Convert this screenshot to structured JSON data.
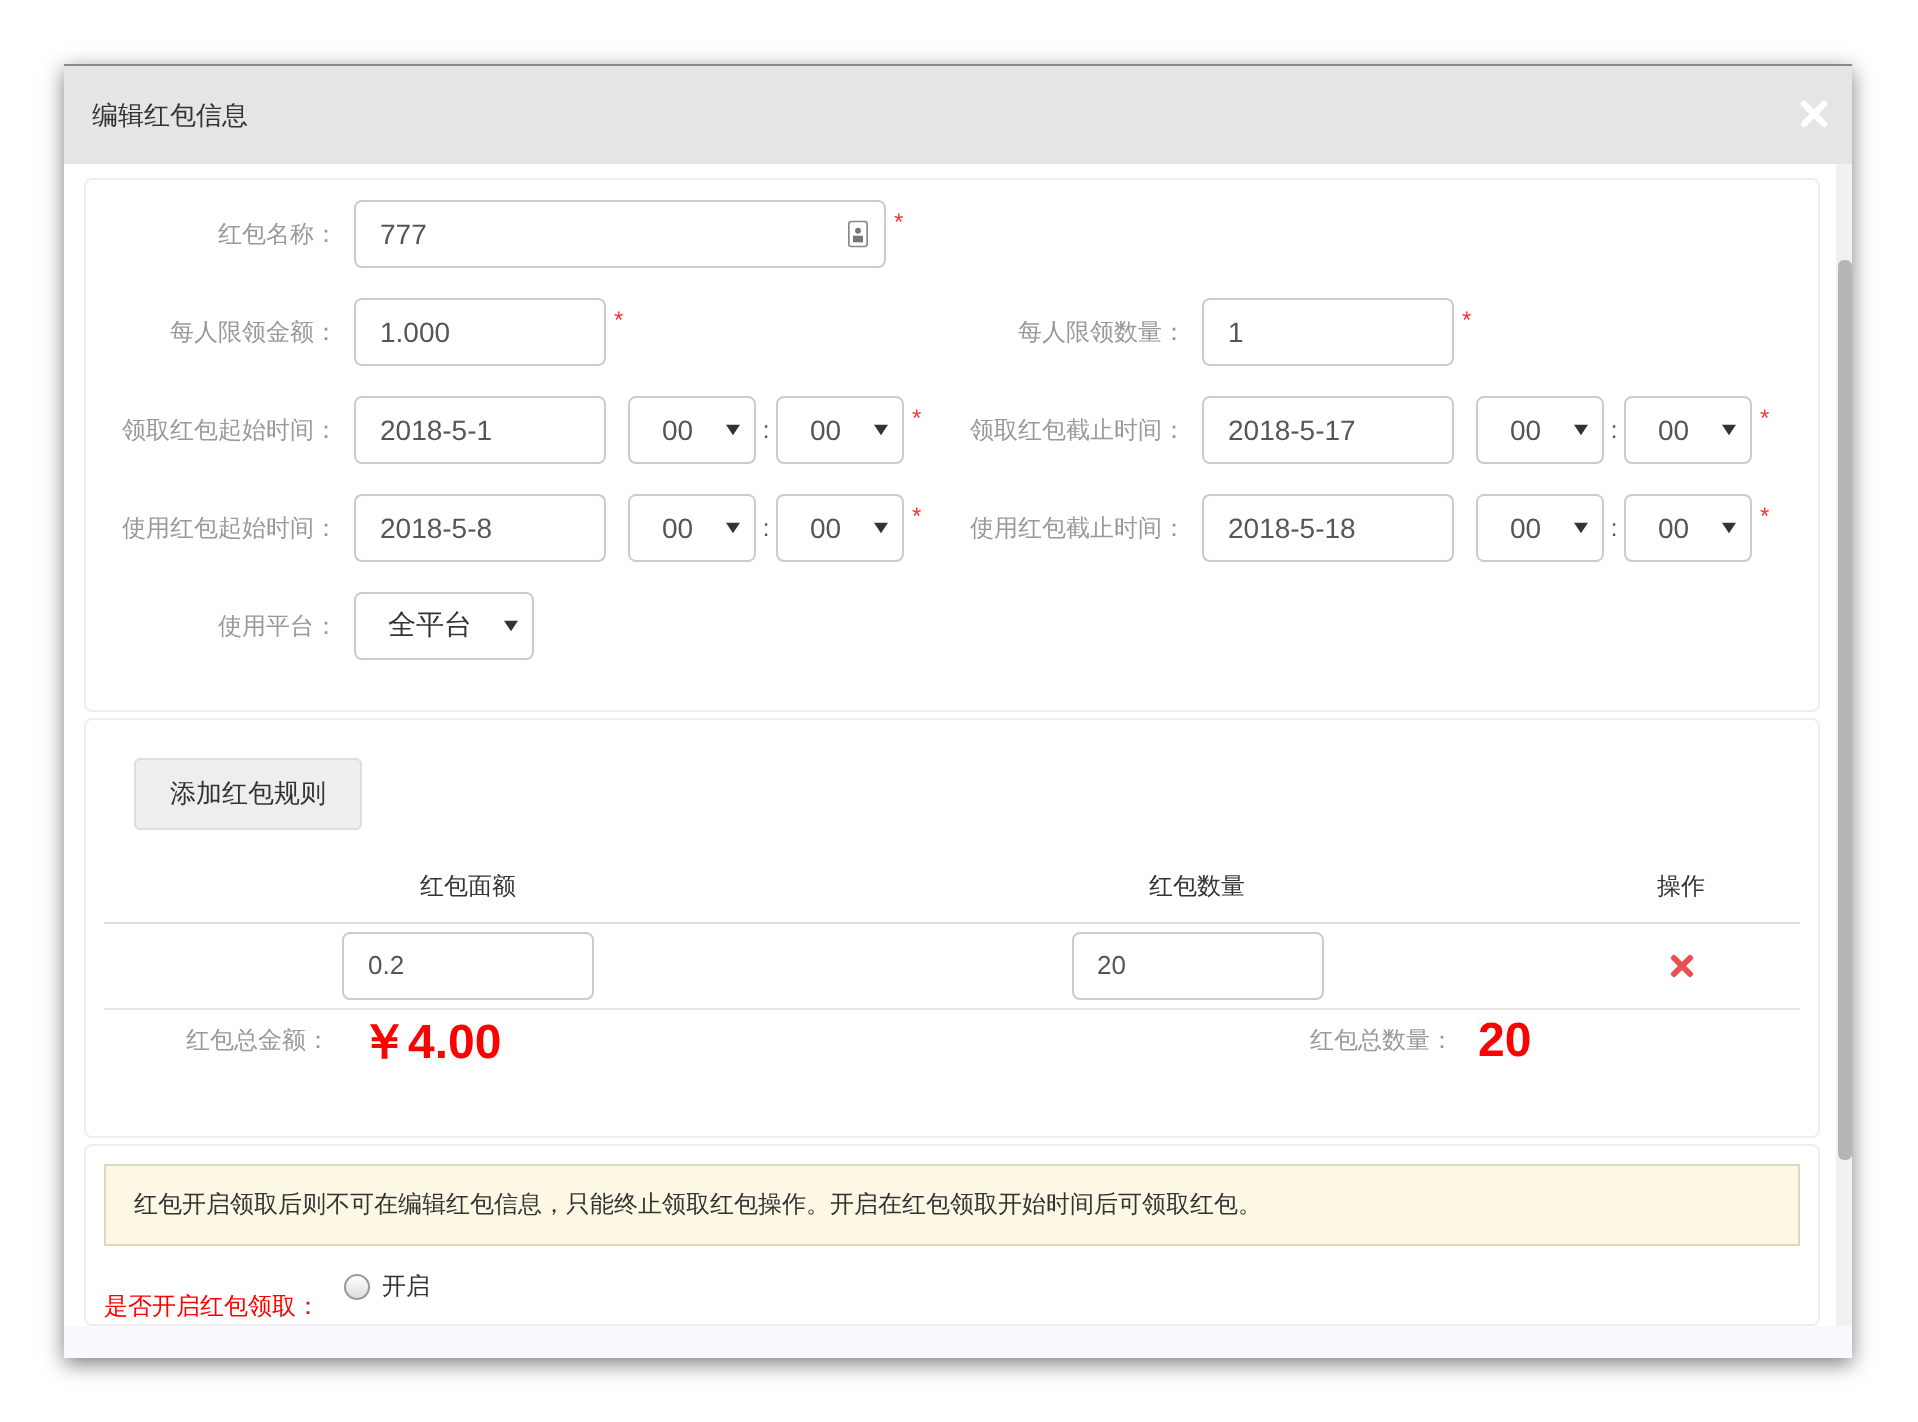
{
  "dialog": {
    "title": "编辑红包信息"
  },
  "form": {
    "name": {
      "label": "红包名称：",
      "value": "777",
      "required": true
    },
    "limits": [
      {
        "label": "每人限领金额：",
        "value": "1.000",
        "required": true
      },
      {
        "label": "每人限领数量：",
        "value": "1",
        "required": true
      }
    ],
    "times": [
      {
        "label": "领取红包起始时间：",
        "date": "2018-5-1",
        "hour": "00",
        "minute": "00",
        "required": true
      },
      {
        "label": "领取红包截止时间：",
        "date": "2018-5-17",
        "hour": "00",
        "minute": "00",
        "required": true
      },
      {
        "label": "使用红包起始时间：",
        "date": "2018-5-8",
        "hour": "00",
        "minute": "00",
        "required": true
      },
      {
        "label": "使用红包截止时间：",
        "date": "2018-5-18",
        "hour": "00",
        "minute": "00",
        "required": true
      }
    ],
    "time_separator": ":",
    "required_mark": "*",
    "platform": {
      "label": "使用平台：",
      "value": "全平台"
    }
  },
  "rules": {
    "add_button": "添加红包规则",
    "columns": [
      "红包面额",
      "红包数量",
      "操作"
    ],
    "rows": [
      {
        "amount": "0.2",
        "count": "20"
      }
    ],
    "totals": {
      "amount_label": "红包总金额：",
      "amount": "￥4.00",
      "count_label": "红包总数量：",
      "count": "20"
    }
  },
  "activation": {
    "notice": "红包开启领取后则不可在编辑红包信息，只能终止领取红包操作。开启在红包领取开始时间后可领取红包。",
    "label": "是否开启红包领取：",
    "options": [
      {
        "label": "开启",
        "selected": false
      }
    ]
  }
}
